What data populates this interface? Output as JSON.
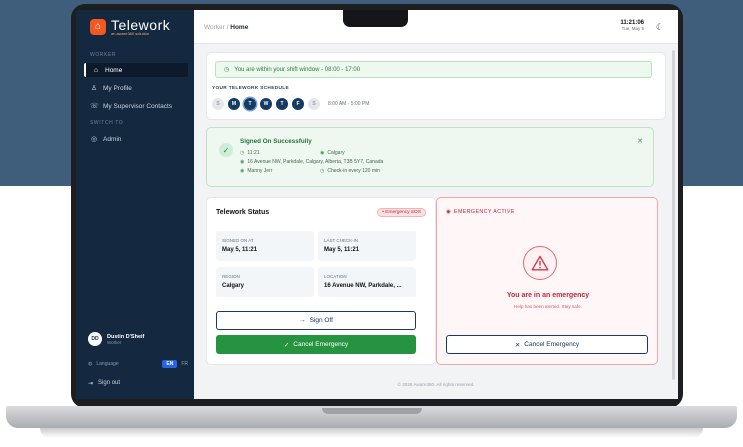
{
  "app": {
    "name": "Telework",
    "tagline": "an aware360 solution"
  },
  "sidebar": {
    "section_worker": "WORKER",
    "section_switch": "SWITCH TO",
    "items": [
      {
        "label": "Home",
        "icon": "home-icon",
        "glyph": "⌂"
      },
      {
        "label": "My Profile",
        "icon": "person-icon",
        "glyph": "♙"
      },
      {
        "label": "My Supervisor Contacts",
        "icon": "contacts-icon",
        "glyph": "☏"
      }
    ],
    "admin": {
      "label": "Admin",
      "icon": "admin-icon",
      "glyph": "◎"
    },
    "user": {
      "initials": "DD",
      "name": "Dustin D'Sheif",
      "role": "Worker"
    },
    "language_label": "Language",
    "lang_en": "EN",
    "lang_fr": "FR",
    "signout": "Sign out"
  },
  "header": {
    "breadcrumb_parent": "Worker",
    "breadcrumb_sep": "/",
    "breadcrumb_current": "Home",
    "time": "11:21:06",
    "date": "Tue, May 5",
    "theme_glyph": "☾"
  },
  "schedule": {
    "shift_message": "You are within your shift window - 08:00 - 17:00",
    "label": "YOUR TELEWORK SCHEDULE",
    "days": [
      "S",
      "M",
      "T",
      "W",
      "T",
      "F",
      "S"
    ],
    "time_range": "8:00 AM - 5:00 PM"
  },
  "signed_on": {
    "title": "Signed On Successfully",
    "time": "11:21",
    "region": "Calgary",
    "address": "16 Avenue NW, Parkdale, Calgary, Alberta, T3B 5Y7, Canada",
    "supervisor": "Manny Jerr",
    "checkin": "Check-in every 120 min"
  },
  "status": {
    "title": "Telework Status",
    "badge": "• Emergency SOS",
    "signed_on_label": "SIGNED ON AT",
    "signed_on_value": "May 5, 11:21",
    "last_checkin_label": "LAST CHECK-IN",
    "last_checkin_value": "May 5, 11:21",
    "region_label": "REGION",
    "region_value": "Calgary",
    "location_label": "LOCATION",
    "location_value": "16 Avenue NW, Parkdale, ...",
    "sign_off": "Sign Off",
    "cancel_emergency": "Cancel Emergency"
  },
  "emergency": {
    "title": "EMERGENCY ACTIVE",
    "heading": "You are in an emergency",
    "sub": "Help has been alerted. Stay safe.",
    "cancel": "Cancel Emergency"
  },
  "footer": "© 2026 Aware360. All rights reserved.",
  "colors": {
    "sidebar": "#14283f",
    "accent_green": "#25933f",
    "emergency_red": "#c2263a",
    "brand_orange": "#f05a22"
  }
}
